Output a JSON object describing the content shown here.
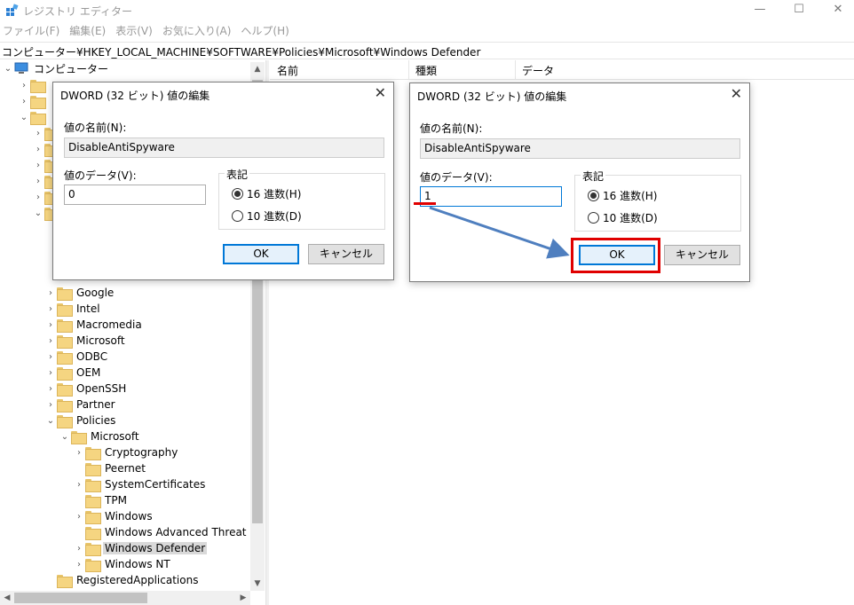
{
  "window": {
    "title": "レジストリ エディター",
    "minimize": "—",
    "maximize": "☐",
    "close": "✕"
  },
  "menu": [
    "ファイル(F)",
    "編集(E)",
    "表示(V)",
    "お気に入り(A)",
    "ヘルプ(H)"
  ],
  "address": "コンピューター¥HKEY_LOCAL_MACHINE¥SOFTWARE¥Policies¥Microsoft¥Windows Defender",
  "tree": {
    "root": "コンピューター",
    "items": [
      "Google",
      "Intel",
      "Macromedia",
      "Microsoft",
      "ODBC",
      "OEM",
      "OpenSSH",
      "Partner",
      "Policies"
    ],
    "microsoft": "Microsoft",
    "microsoft_children": [
      "Cryptography",
      "Peernet",
      "SystemCertificates",
      "TPM",
      "Windows",
      "Windows Advanced Threat Pro",
      "Windows Defender",
      "Windows NT"
    ],
    "after": "RegisteredApplications",
    "selected": "Windows Defender"
  },
  "list_columns": [
    "名前",
    "種類",
    "データ"
  ],
  "dialog_left": {
    "title": "DWORD (32 ビット) 値の編集",
    "value_name_label": "値の名前(N):",
    "value_name": "DisableAntiSpyware",
    "value_data_label": "値のデータ(V):",
    "value_data": "0",
    "base_label": "表記",
    "hex_label": "16 進数(H)",
    "dec_label": "10 進数(D)",
    "ok": "OK",
    "cancel": "キャンセル"
  },
  "dialog_right": {
    "title": "DWORD (32 ビット) 値の編集",
    "value_name_label": "値の名前(N):",
    "value_name": "DisableAntiSpyware",
    "value_data_label": "値のデータ(V):",
    "value_data": "1",
    "base_label": "表記",
    "hex_label": "16 進数(H)",
    "dec_label": "10 進数(D)",
    "ok": "OK",
    "cancel": "キャンセル"
  },
  "colors": {
    "highlight": "#e00000",
    "arrow": "#4f7fbf",
    "accent": "#0078d7"
  }
}
